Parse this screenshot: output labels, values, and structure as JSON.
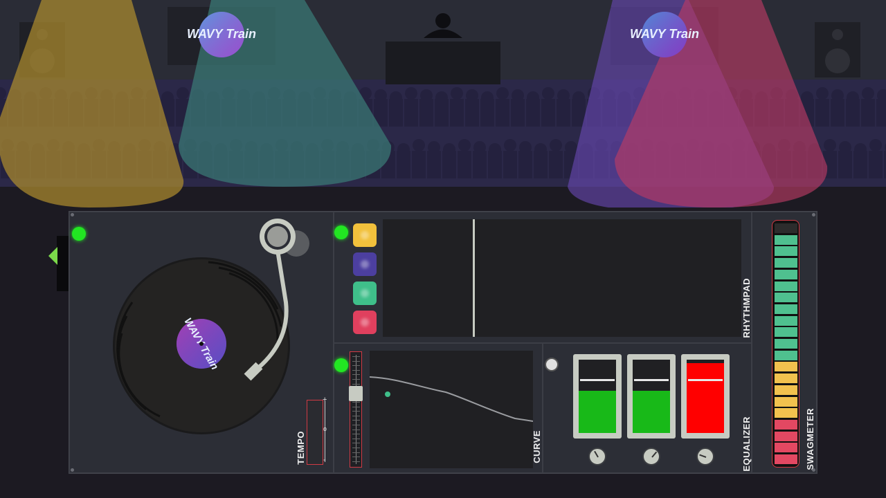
{
  "stage": {
    "banner_logo_text": "WAVY Train",
    "colors": {
      "backdrop": "#2a2c36",
      "crowd": "#2b2848",
      "beam_yellow": "#b08e2e",
      "beam_teal": "#3a7a76",
      "beam_purple": "#6a4ab8",
      "beam_pink": "#b83a64"
    }
  },
  "turntable": {
    "record_label_text": "WAVY Train",
    "tempo_label": "TEMPO",
    "tempo_plus": "+",
    "tempo_minus": "-",
    "tempo_mark": "o",
    "led_color": "#22e622"
  },
  "rhythmpad": {
    "label": "RHYTHMPAD",
    "pads": [
      {
        "name": "pad-yellow",
        "color": "#f2c13c"
      },
      {
        "name": "pad-purple",
        "color": "#4c3fa0"
      },
      {
        "name": "pad-green",
        "color": "#3fbf8a"
      },
      {
        "name": "pad-pink",
        "color": "#e0405e"
      }
    ]
  },
  "curve": {
    "label": "CURVE"
  },
  "equalizer": {
    "label": "EQUALIZER",
    "channels": [
      {
        "name": "low",
        "level": 0.58,
        "color": "#18b918"
      },
      {
        "name": "mid",
        "level": 0.58,
        "color": "#18b918"
      },
      {
        "name": "high",
        "level": 0.95,
        "color": "#ff0000"
      }
    ]
  },
  "swagmeter": {
    "label": "SWAGMETER",
    "segments": [
      "#2c2c2c",
      "#4fc08f",
      "#4fc08f",
      "#4fc08f",
      "#4fc08f",
      "#4fc08f",
      "#4fc08f",
      "#4fc08f",
      "#4fc08f",
      "#4fc08f",
      "#4fc08f",
      "#4fc08f",
      "#f2c14e",
      "#f2c14e",
      "#f2c14e",
      "#f2c14e",
      "#f2c14e",
      "#e34862",
      "#e34862",
      "#e34862",
      "#e34862"
    ]
  }
}
